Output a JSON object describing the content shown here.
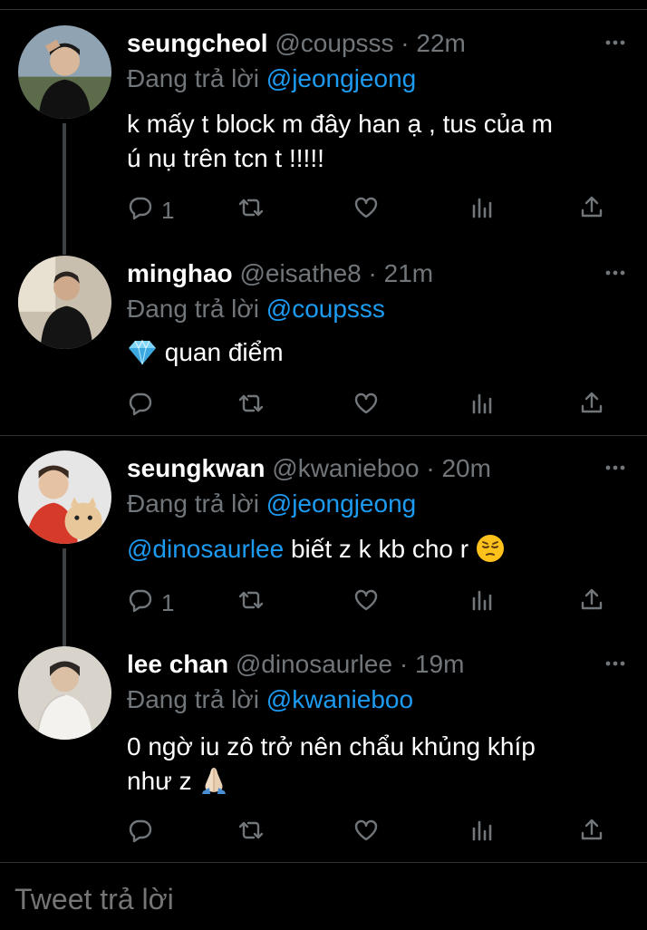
{
  "tweets": [
    {
      "name": "seungcheol",
      "handle": "@coupsss",
      "dot": "·",
      "time": "22m",
      "reply_prefix": "Đang trả lời",
      "reply_to": "@jeongjeong",
      "text_line1": "k mấy t block m đây han ạ , tus của m",
      "text_line2": "ú nụ trên tcn t !!!!!",
      "reply_count": "1"
    },
    {
      "name": "minghao",
      "handle": "@eisathe8",
      "dot": "·",
      "time": "21m",
      "reply_prefix": "Đang trả lời",
      "reply_to": "@coupsss",
      "text": "quan điểm",
      "emoji": "gem-emoji"
    },
    {
      "name": "seungkwan",
      "handle": "@kwanieboo",
      "dot": "·",
      "time": "20m",
      "reply_prefix": "Đang trả lời",
      "reply_to": "@jeongjeong",
      "text_mention": "@dinosaurlee",
      "text": " biết z k kb cho r",
      "emoji": "pensive-face-emoji",
      "reply_count": "1"
    },
    {
      "name": "lee chan",
      "handle": "@dinosaurlee",
      "dot": "·",
      "time": "19m",
      "reply_prefix": "Đang trả lời",
      "reply_to": "@kwanieboo",
      "text_line1": "0 ngờ iu zô trở nên chẩu khủng khíp",
      "text_line2": "như z",
      "emoji": "folded-hands-emoji"
    }
  ],
  "composer": {
    "placeholder": "Tweet trả lời"
  },
  "colors": {
    "background": "#000000",
    "accent": "#1d9bf0",
    "muted": "#71767b",
    "divider": "#2f3336"
  },
  "icons": [
    "more-icon",
    "reply-icon",
    "retweet-icon",
    "like-icon",
    "analytics-icon",
    "share-icon"
  ]
}
